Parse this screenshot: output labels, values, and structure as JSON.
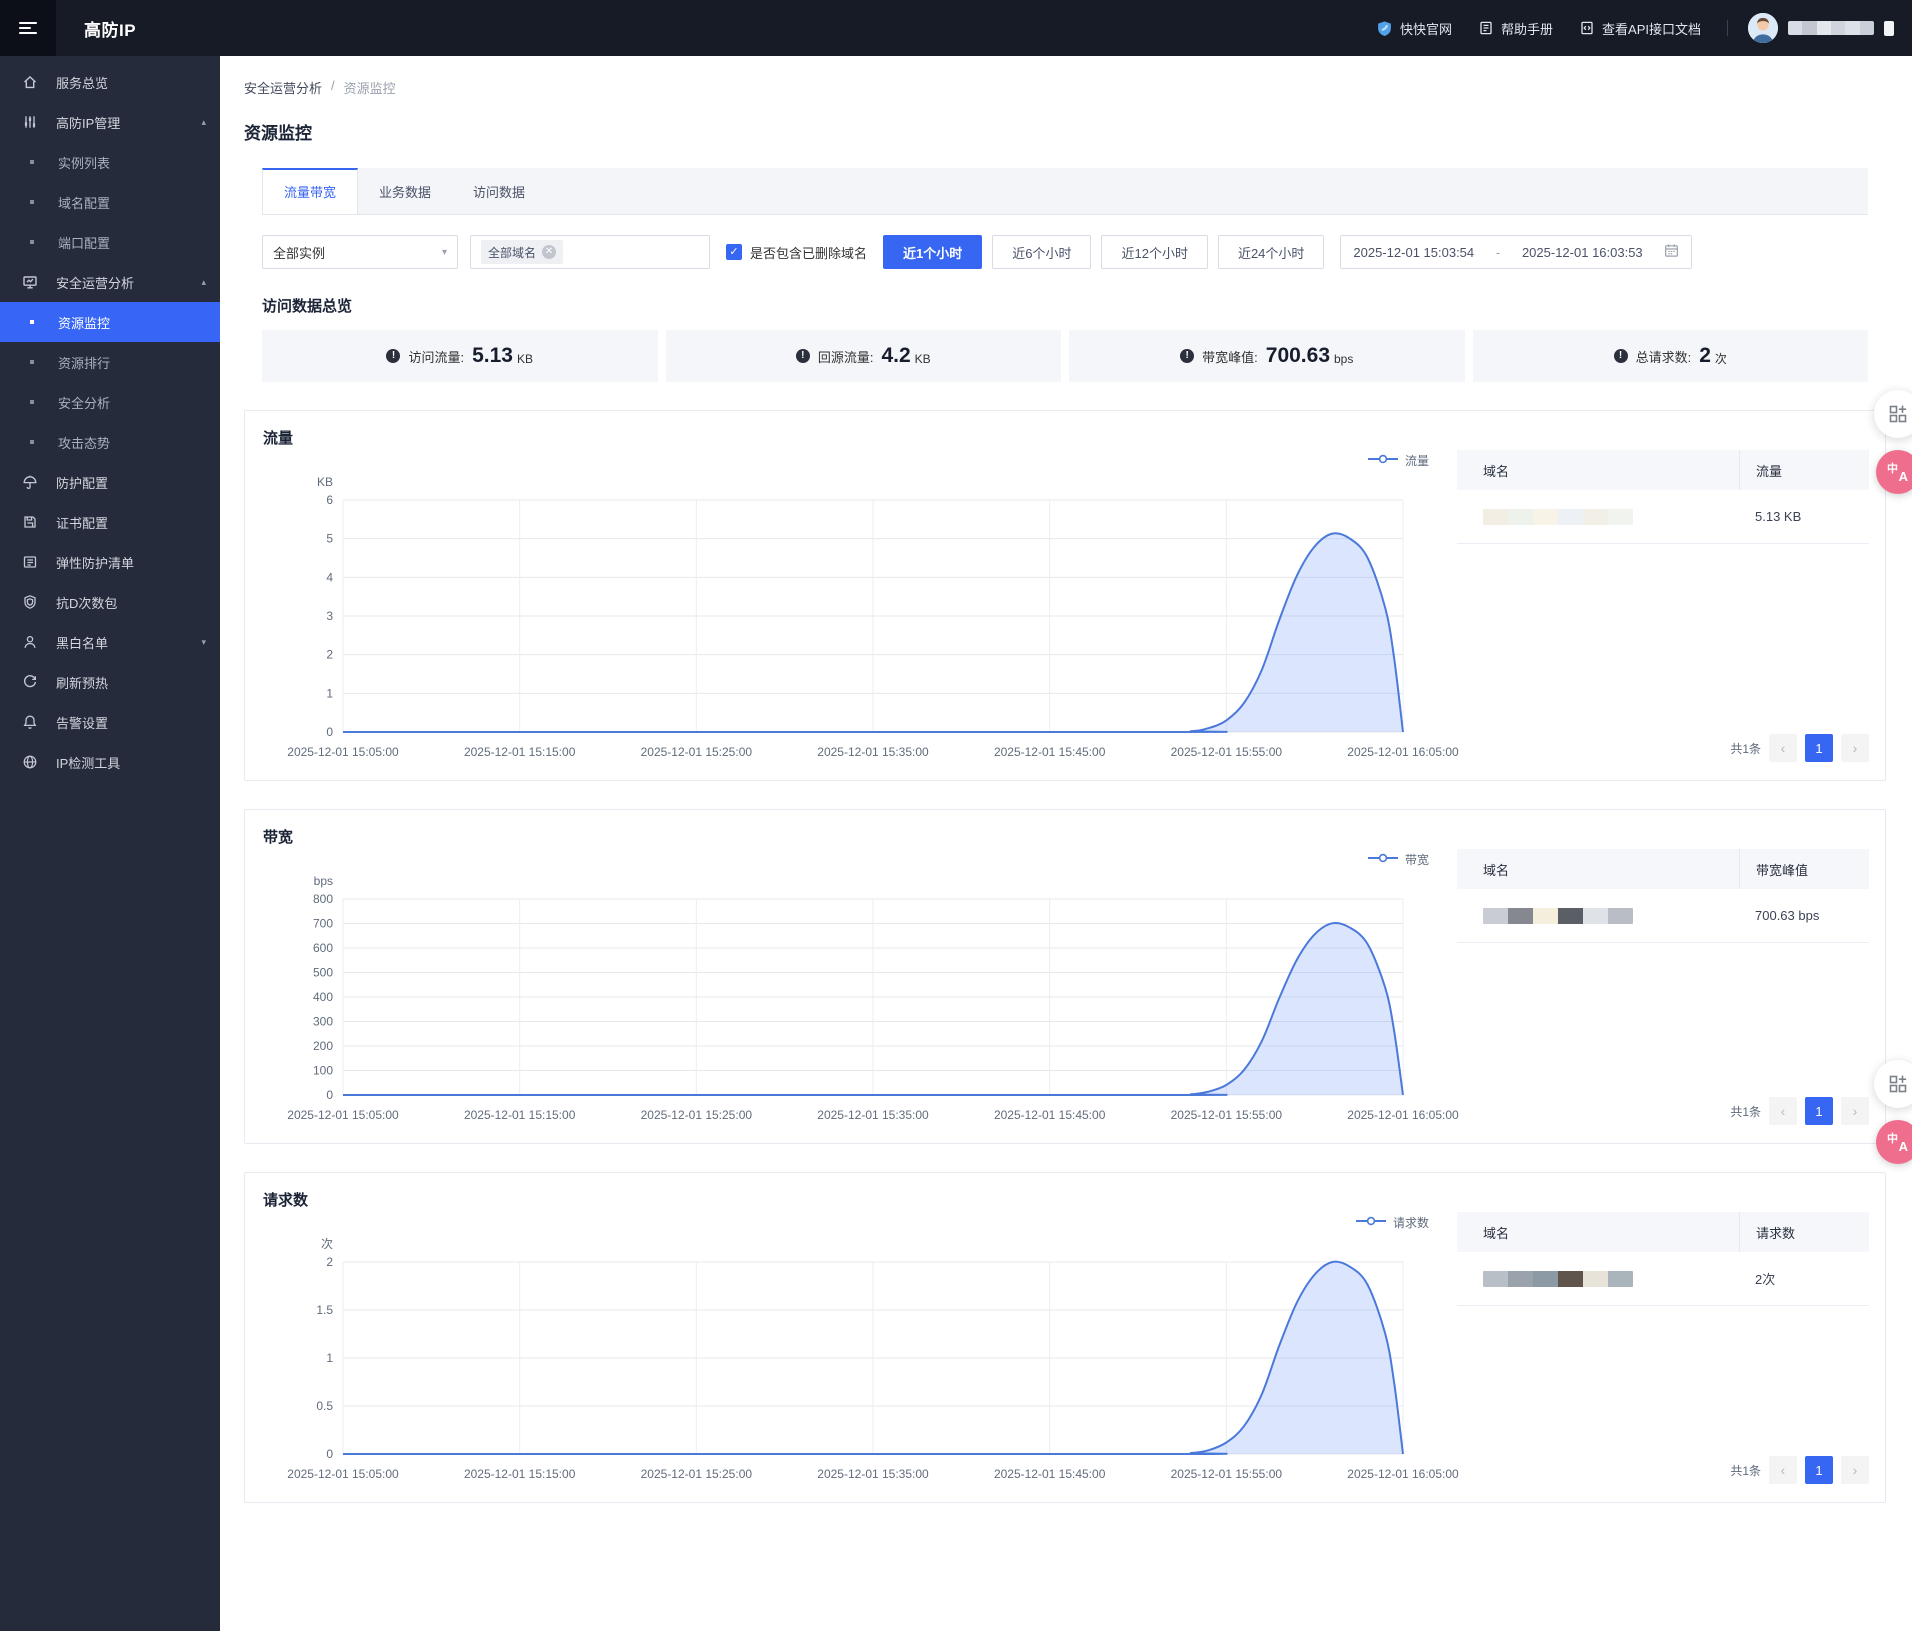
{
  "header": {
    "logo": "高防IP",
    "links": [
      {
        "label": "快快官网"
      },
      {
        "label": "帮助手册"
      },
      {
        "label": "查看API接口文档"
      }
    ]
  },
  "sidebar": {
    "items": [
      {
        "label": "服务总览",
        "icon": "home-icon",
        "type": "top"
      },
      {
        "label": "高防IP管理",
        "icon": "sliders-icon",
        "type": "group",
        "expanded": true
      },
      {
        "label": "实例列表",
        "type": "sub"
      },
      {
        "label": "域名配置",
        "type": "sub"
      },
      {
        "label": "端口配置",
        "type": "sub"
      },
      {
        "label": "安全运营分析",
        "icon": "monitor-icon",
        "type": "group",
        "expanded": true
      },
      {
        "label": "资源监控",
        "type": "sub",
        "selected": true
      },
      {
        "label": "资源排行",
        "type": "sub"
      },
      {
        "label": "安全分析",
        "type": "sub"
      },
      {
        "label": "攻击态势",
        "type": "sub"
      },
      {
        "label": "防护配置",
        "icon": "umbrella-icon",
        "type": "top"
      },
      {
        "label": "证书配置",
        "icon": "certificate-icon",
        "type": "top"
      },
      {
        "label": "弹性防护清单",
        "icon": "list-icon",
        "type": "top"
      },
      {
        "label": "抗D次数包",
        "icon": "shield-icon",
        "type": "top"
      },
      {
        "label": "黑白名单",
        "icon": "user-icon",
        "type": "group",
        "expanded": false
      },
      {
        "label": "刷新预热",
        "icon": "refresh-icon",
        "type": "top"
      },
      {
        "label": "告警设置",
        "icon": "bell-icon",
        "type": "top"
      },
      {
        "label": "IP检测工具",
        "icon": "globe-icon",
        "type": "top"
      }
    ]
  },
  "breadcrumb": {
    "parent": "安全运营分析",
    "separator": "/",
    "current": "资源监控"
  },
  "page_title": "资源监控",
  "tabs": [
    {
      "label": "流量带宽",
      "active": true
    },
    {
      "label": "业务数据",
      "active": false
    },
    {
      "label": "访问数据",
      "active": false
    }
  ],
  "filters": {
    "instance_select": "全部实例",
    "domain_tag": "全部域名",
    "checkbox_label": "是否包含已删除域名",
    "checkbox_checked": true,
    "time_buttons": [
      {
        "label": "近1个小时",
        "active": true
      },
      {
        "label": "近6个小时",
        "active": false
      },
      {
        "label": "近12个小时",
        "active": false
      },
      {
        "label": "近24个小时",
        "active": false
      }
    ],
    "date_start": "2025-12-01 15:03:54",
    "date_separator": "-",
    "date_end": "2025-12-01 16:03:53"
  },
  "overview": {
    "title": "访问数据总览",
    "stats": [
      {
        "label": "访问流量:",
        "value": "5.13",
        "unit": "KB"
      },
      {
        "label": "回源流量:",
        "value": "4.2",
        "unit": "KB"
      },
      {
        "label": "带宽峰值:",
        "value": "700.63",
        "unit": "bps"
      },
      {
        "label": "总请求数:",
        "value": "2",
        "unit": "次"
      }
    ]
  },
  "chart_data": [
    {
      "type": "area",
      "title": "流量",
      "unit": "KB",
      "legend": "流量",
      "ylim": [
        0,
        6
      ],
      "yticks": [
        0,
        1,
        2,
        3,
        4,
        5,
        6
      ],
      "x_labels": [
        "2025-12-01 15:05:00",
        "2025-12-01 15:15:00",
        "2025-12-01 15:25:00",
        "2025-12-01 15:35:00",
        "2025-12-01 15:45:00",
        "2025-12-01 15:55:00",
        "2025-12-01 16:05:00"
      ],
      "x_minutes_range": [
        0,
        60
      ],
      "series": [
        {
          "name": "流量",
          "points": [
            [
              0,
              0
            ],
            [
              46,
              0
            ],
            [
              48,
              0.02
            ],
            [
              49,
              0.1
            ],
            [
              50,
              0.3
            ],
            [
              51,
              0.75
            ],
            [
              52,
              1.6
            ],
            [
              53,
              2.9
            ],
            [
              54,
              4.05
            ],
            [
              55,
              4.8
            ],
            [
              56,
              5.13
            ],
            [
              57,
              5.0
            ],
            [
              58,
              4.5
            ],
            [
              59,
              3.2
            ],
            [
              59.5,
              1.9
            ],
            [
              60,
              0
            ]
          ]
        }
      ],
      "table": {
        "columns": [
          "域名",
          "流量"
        ],
        "rows": [
          {
            "domain_redacted": true,
            "value": "5.13 KB"
          }
        ],
        "total_label": "共1条",
        "page": "1"
      }
    },
    {
      "type": "area",
      "title": "带宽",
      "unit": "bps",
      "legend": "带宽",
      "ylim": [
        0,
        800
      ],
      "yticks": [
        0,
        100,
        200,
        300,
        400,
        500,
        600,
        700,
        800
      ],
      "x_labels": [
        "2025-12-01 15:05:00",
        "2025-12-01 15:15:00",
        "2025-12-01 15:25:00",
        "2025-12-01 15:35:00",
        "2025-12-01 15:45:00",
        "2025-12-01 15:55:00",
        "2025-12-01 16:05:00"
      ],
      "x_minutes_range": [
        0,
        60
      ],
      "series": [
        {
          "name": "带宽",
          "points": [
            [
              0,
              0
            ],
            [
              46,
              0
            ],
            [
              48,
              3
            ],
            [
              49,
              14
            ],
            [
              50,
              41
            ],
            [
              51,
              102
            ],
            [
              52,
              219
            ],
            [
              53,
              396
            ],
            [
              54,
              553
            ],
            [
              55,
              656
            ],
            [
              56,
              700.63
            ],
            [
              57,
              683
            ],
            [
              58,
              615
            ],
            [
              59,
              437
            ],
            [
              59.5,
              260
            ],
            [
              60,
              0
            ]
          ]
        }
      ],
      "table": {
        "columns": [
          "域名",
          "带宽峰值"
        ],
        "rows": [
          {
            "domain_redacted": true,
            "value": "700.63 bps"
          }
        ],
        "total_label": "共1条",
        "page": "1"
      }
    },
    {
      "type": "area",
      "title": "请求数",
      "unit": "次",
      "legend": "请求数",
      "ylim": [
        0,
        2
      ],
      "yticks": [
        0,
        0.5,
        1,
        1.5,
        2
      ],
      "x_labels": [
        "2025-12-01 15:05:00",
        "2025-12-01 15:15:00",
        "2025-12-01 15:25:00",
        "2025-12-01 15:35:00",
        "2025-12-01 15:45:00",
        "2025-12-01 15:55:00",
        "2025-12-01 16:05:00"
      ],
      "x_minutes_range": [
        0,
        60
      ],
      "series": [
        {
          "name": "请求数",
          "points": [
            [
              0,
              0
            ],
            [
              46,
              0
            ],
            [
              48,
              0.01
            ],
            [
              49,
              0.04
            ],
            [
              50,
              0.12
            ],
            [
              51,
              0.29
            ],
            [
              52,
              0.62
            ],
            [
              53,
              1.13
            ],
            [
              54,
              1.58
            ],
            [
              55,
              1.87
            ],
            [
              56,
              2
            ],
            [
              57,
              1.95
            ],
            [
              58,
              1.76
            ],
            [
              59,
              1.25
            ],
            [
              59.5,
              0.74
            ],
            [
              60,
              0
            ]
          ]
        }
      ],
      "table": {
        "columns": [
          "域名",
          "请求数"
        ],
        "rows": [
          {
            "domain_redacted": true,
            "value": "2次"
          }
        ],
        "total_label": "共1条",
        "page": "1"
      }
    }
  ],
  "floating": {
    "translate_zh": "中",
    "translate_en": "A"
  },
  "colors": {
    "accent": "#3766f3",
    "line": "#4b79da",
    "area_fill": "rgba(91,143,249,0.22)",
    "header_bg": "#171b26",
    "sidebar_bg": "#252b3a",
    "sidebar_selected": "#3766f7",
    "chart_grid": "#e8e8ec"
  }
}
